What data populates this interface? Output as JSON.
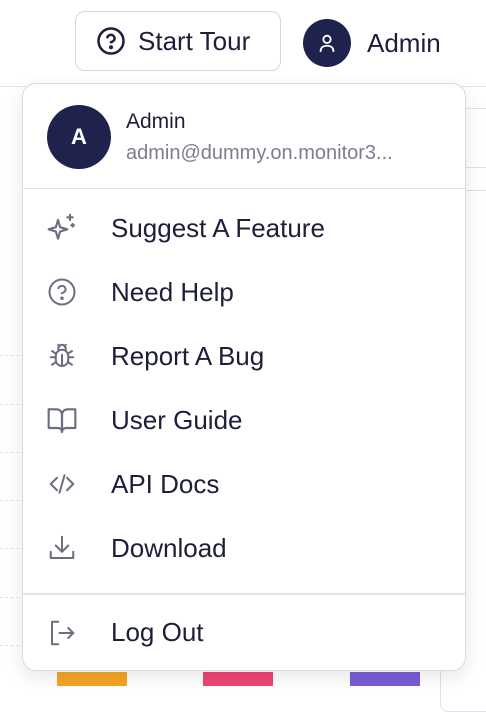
{
  "header": {
    "tour_label": "Start Tour",
    "user_label": "Admin"
  },
  "profile": {
    "avatar_initial": "A",
    "name": "Admin",
    "email": "admin@dummy.on.monitor3..."
  },
  "menu": {
    "items": [
      {
        "label": "Suggest A Feature",
        "icon": "sparkles-icon"
      },
      {
        "label": "Need Help",
        "icon": "help-circle-icon"
      },
      {
        "label": "Report A Bug",
        "icon": "bug-icon"
      },
      {
        "label": "User Guide",
        "icon": "book-open-icon"
      },
      {
        "label": "API Docs",
        "icon": "code-icon"
      },
      {
        "label": "Download",
        "icon": "download-icon"
      }
    ],
    "logout_label": "Log Out",
    "logout_icon": "log-out-icon"
  },
  "colors": {
    "avatar_bg": "#20224e",
    "text": "#1d1f3a",
    "muted_text": "#7b7e8f",
    "icon": "#6b6e80"
  }
}
